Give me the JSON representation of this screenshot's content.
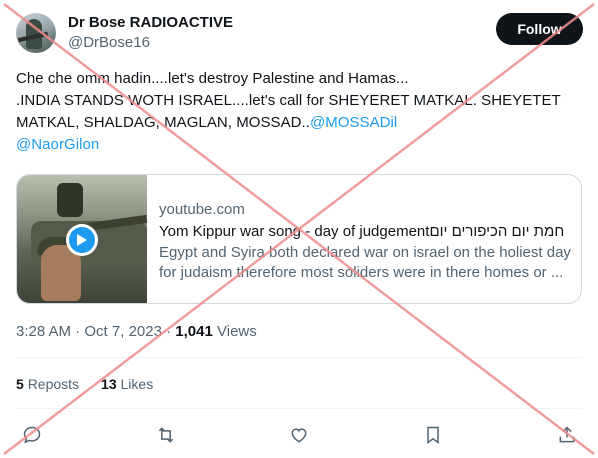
{
  "user": {
    "display_name": "Dr Bose RADIOACTIVE",
    "handle": "@DrBose16",
    "follow_label": "Follow"
  },
  "tweet": {
    "line1": "Che che omm hadin....let's destroy Palestine and Hamas...",
    "line2": ".INDIA STANDS WOTH ISRAEL....let's call for SHEYERET MATKAL. SHEYETET",
    "line3_text": "MATKAL, SHALDAG, MAGLAN, MOSSAD..",
    "mention1": "@MOSSADil",
    "mention2": "@NaorGilon"
  },
  "card": {
    "domain": "youtube.com",
    "title": "Yom Kippur war song - day of judgementחמת יום הכיפורים יום",
    "desc_line1": "Egypt and Syira both declared war on israel on the holiest day",
    "desc_line2": "for judaism therefore most soliders were in there homes or ..."
  },
  "meta": {
    "time": "3:28 AM",
    "separator": " · ",
    "date": "Oct 7, 2023",
    "views_count": "1,041",
    "views_label": "Views"
  },
  "stats": {
    "reposts_count": "5",
    "reposts_label": "Reposts",
    "likes_count": "13",
    "likes_label": "Likes"
  },
  "actions": [
    "reply-icon",
    "repost-icon",
    "like-icon",
    "bookmark-icon",
    "share-icon"
  ],
  "colors": {
    "accent": "#1d9bf0",
    "text": "#0f1419",
    "muted": "#536471",
    "overlay_x": "#f08c8c"
  }
}
